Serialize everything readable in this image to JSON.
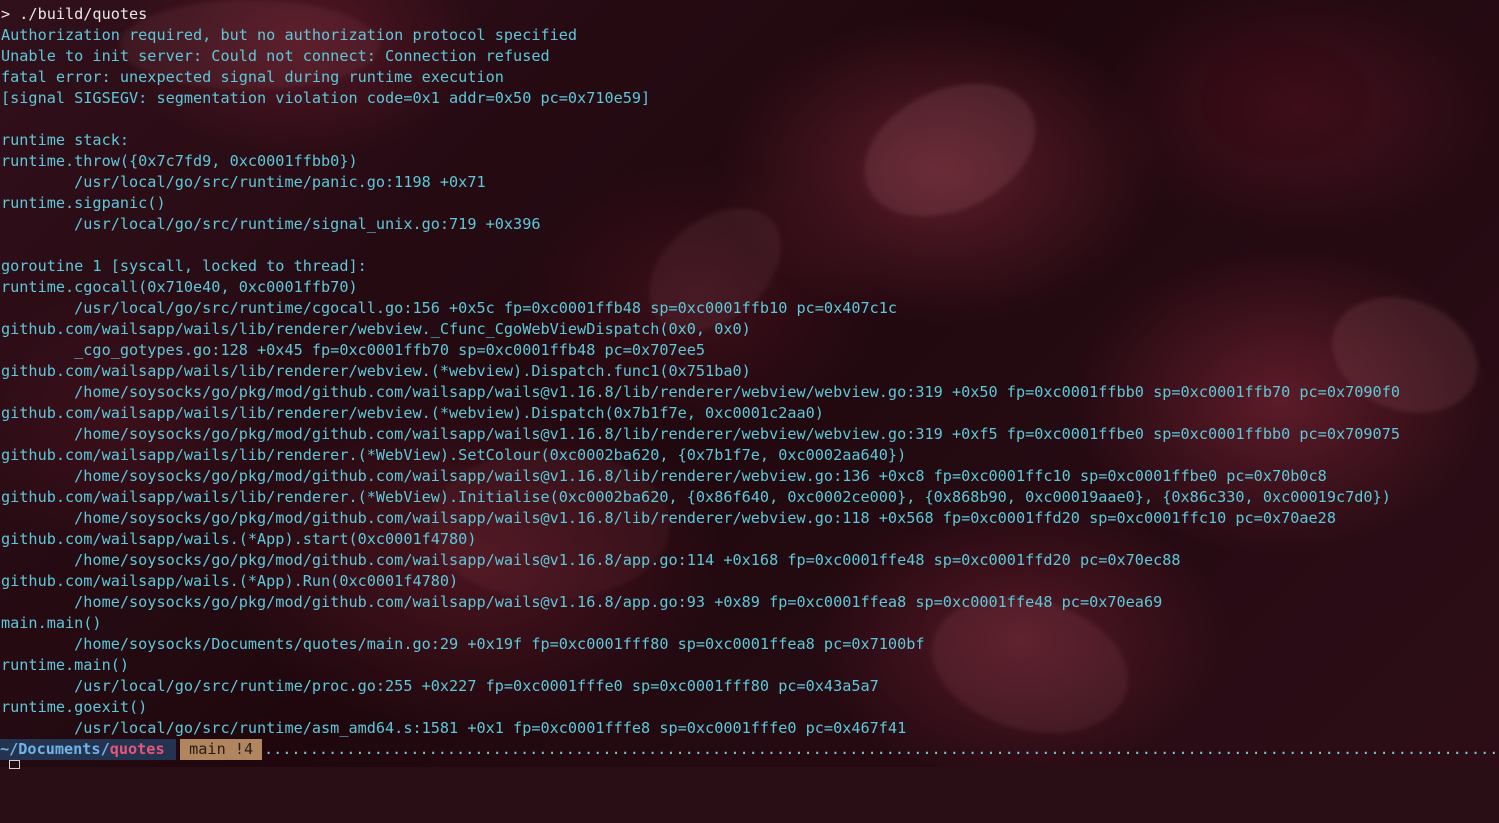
{
  "theme": {
    "text_color": "#5ec8d8",
    "command_color": "#e8e8e8",
    "path_bg": "#24334f",
    "path_color": "#6fb3e8",
    "repo_color": "#e7567a",
    "git_bg": "#b08660"
  },
  "terminal": {
    "lines": [
      "> ./build/quotes",
      "Authorization required, but no authorization protocol specified",
      "Unable to init server: Could not connect: Connection refused",
      "fatal error: unexpected signal during runtime execution",
      "[signal SIGSEGV: segmentation violation code=0x1 addr=0x50 pc=0x710e59]",
      "",
      "runtime stack:",
      "runtime.throw({0x7c7fd9, 0xc0001ffbb0})",
      "        /usr/local/go/src/runtime/panic.go:1198 +0x71",
      "runtime.sigpanic()",
      "        /usr/local/go/src/runtime/signal_unix.go:719 +0x396",
      "",
      "goroutine 1 [syscall, locked to thread]:",
      "runtime.cgocall(0x710e40, 0xc0001ffb70)",
      "        /usr/local/go/src/runtime/cgocall.go:156 +0x5c fp=0xc0001ffb48 sp=0xc0001ffb10 pc=0x407c1c",
      "github.com/wailsapp/wails/lib/renderer/webview._Cfunc_CgoWebViewDispatch(0x0, 0x0)",
      "        _cgo_gotypes.go:128 +0x45 fp=0xc0001ffb70 sp=0xc0001ffb48 pc=0x707ee5",
      "github.com/wailsapp/wails/lib/renderer/webview.(*webview).Dispatch.func1(0x751ba0)",
      "        /home/soysocks/go/pkg/mod/github.com/wailsapp/wails@v1.16.8/lib/renderer/webview/webview.go:319 +0x50 fp=0xc0001ffbb0 sp=0xc0001ffb70 pc=0x7090f0",
      "github.com/wailsapp/wails/lib/renderer/webview.(*webview).Dispatch(0x7b1f7e, 0xc0001c2aa0)",
      "        /home/soysocks/go/pkg/mod/github.com/wailsapp/wails@v1.16.8/lib/renderer/webview/webview.go:319 +0xf5 fp=0xc0001ffbe0 sp=0xc0001ffbb0 pc=0x709075",
      "github.com/wailsapp/wails/lib/renderer.(*WebView).SetColour(0xc0002ba620, {0x7b1f7e, 0xc0002aa640})",
      "        /home/soysocks/go/pkg/mod/github.com/wailsapp/wails@v1.16.8/lib/renderer/webview.go:136 +0xc8 fp=0xc0001ffc10 sp=0xc0001ffbe0 pc=0x70b0c8",
      "github.com/wailsapp/wails/lib/renderer.(*WebView).Initialise(0xc0002ba620, {0x86f640, 0xc0002ce000}, {0x868b90, 0xc00019aae0}, {0x86c330, 0xc00019c7d0})",
      "        /home/soysocks/go/pkg/mod/github.com/wailsapp/wails@v1.16.8/lib/renderer/webview.go:118 +0x568 fp=0xc0001ffd20 sp=0xc0001ffc10 pc=0x70ae28",
      "github.com/wailsapp/wails.(*App).start(0xc0001f4780)",
      "        /home/soysocks/go/pkg/mod/github.com/wailsapp/wails@v1.16.8/app.go:114 +0x168 fp=0xc0001ffe48 sp=0xc0001ffd20 pc=0x70ec88",
      "github.com/wailsapp/wails.(*App).Run(0xc0001f4780)",
      "        /home/soysocks/go/pkg/mod/github.com/wailsapp/wails@v1.16.8/app.go:93 +0x89 fp=0xc0001ffea8 sp=0xc0001ffe48 pc=0x70ea69",
      "main.main()",
      "        /home/soysocks/Documents/quotes/main.go:29 +0x19f fp=0xc0001fff80 sp=0xc0001ffea8 pc=0x7100bf",
      "runtime.main()",
      "        /usr/local/go/src/runtime/proc.go:255 +0x227 fp=0xc0001fffe0 sp=0xc0001fff80 pc=0x43a5a7",
      "runtime.goexit()",
      "        /usr/local/go/src/runtime/asm_amd64.s:1581 +0x1 fp=0xc0001fffe8 sp=0xc0001fffe0 pc=0x467f41"
    ]
  },
  "statusbar": {
    "path_prefix": "~/Documents/",
    "path_repo": "quotes",
    "git_status": " main !4 ",
    "filler": "......................................................................................................................................................"
  }
}
